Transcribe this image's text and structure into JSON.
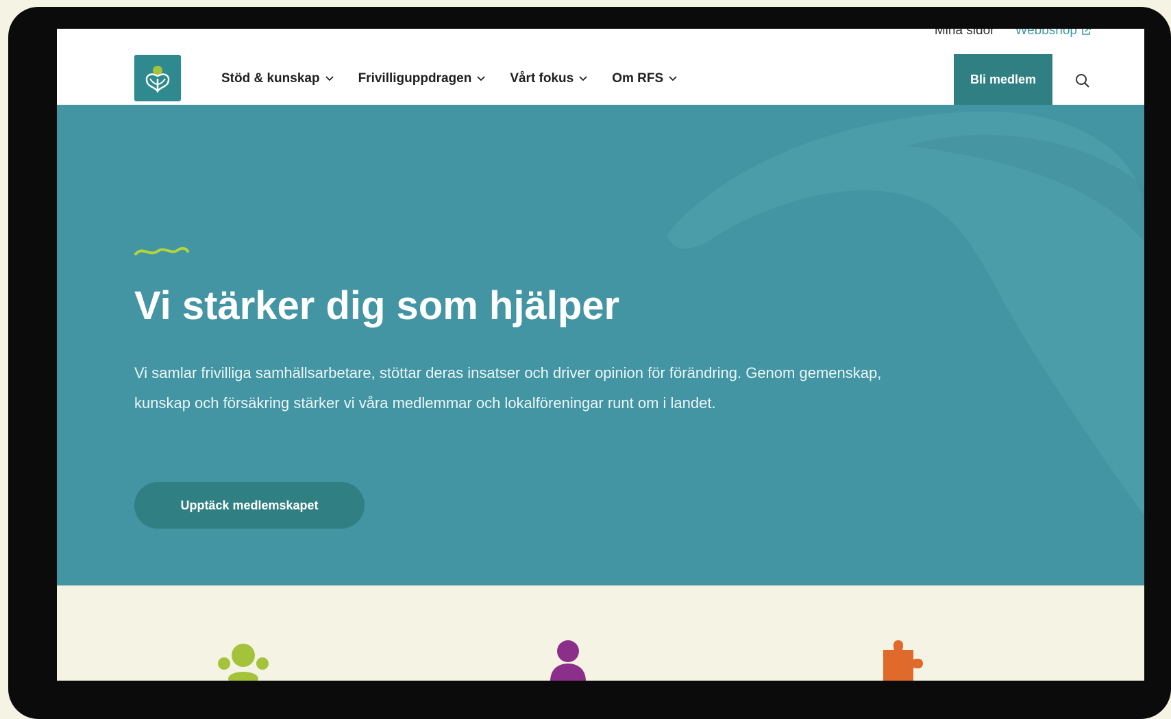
{
  "utility_nav": {
    "my_pages": "Mina sidor",
    "webshop": "Webbshop",
    "webshop_icon": "external-link-icon"
  },
  "header": {
    "logo_icon": "rfs-logo-icon",
    "nav": [
      {
        "label": "Stöd & kunskap",
        "icon": "chevron-down-icon"
      },
      {
        "label": "Frivilliguppdragen",
        "icon": "chevron-down-icon"
      },
      {
        "label": "Vårt fokus",
        "icon": "chevron-down-icon"
      },
      {
        "label": "Om RFS",
        "icon": "chevron-down-icon"
      }
    ],
    "join_button": "Bli medlem",
    "search_icon": "search-icon"
  },
  "hero": {
    "title": "Vi stärker dig som hjälper",
    "text": "Vi samlar frivilliga samhällsarbetare, stöttar deras insatser och driver opinion för förändring. Genom gemenskap, kunskap och försäkring stärker vi våra medlemmar och lokalföreningar runt om i landet.",
    "cta": "Upptäck medlemskapet"
  },
  "colors": {
    "hero_background": "#4495a4",
    "brand_teal": "#2f7f83",
    "accent_green": "#a4c33b",
    "accent_purple": "#8b2f8a",
    "accent_orange": "#e06a2b",
    "page_cream": "#f5f3e4"
  },
  "features": {
    "icons": [
      "group-icon",
      "person-icon",
      "puzzle-icon"
    ]
  }
}
